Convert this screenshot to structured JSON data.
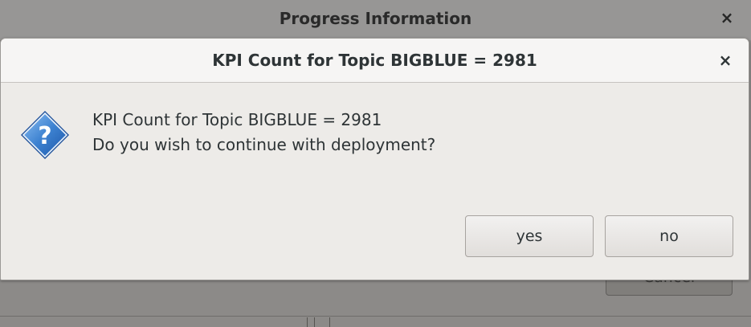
{
  "background_dialog": {
    "title": "Progress Information",
    "close_glyph": "×",
    "cancel_label": "Cancel"
  },
  "dialog": {
    "title": "KPI Count for Topic BIGBLUE = 2981",
    "close_glyph": "×",
    "icon": "question-icon",
    "message_line1": "KPI Count for Topic BIGBLUE = 2981",
    "message_line2": "Do you wish to continue with deployment?",
    "yes_label": "yes",
    "no_label": "no"
  },
  "colors": {
    "icon_blue": "#2f6fc1",
    "icon_light": "#7fb2ea",
    "dim_background": "#8c8a88"
  }
}
